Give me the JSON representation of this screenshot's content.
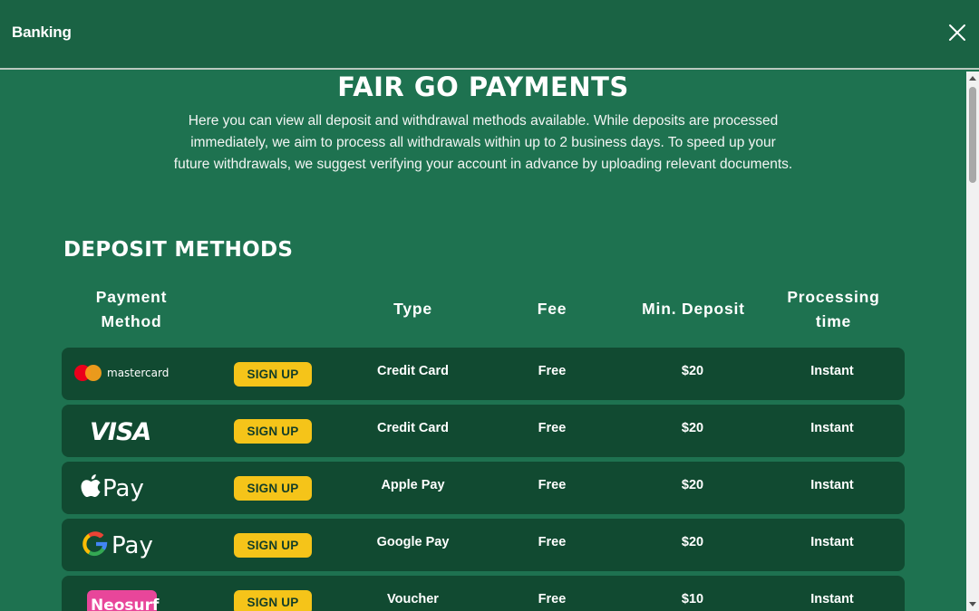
{
  "header": {
    "title": "Banking",
    "close_icon": "close-icon"
  },
  "page": {
    "title": "FAIR GO PAYMENTS",
    "intro": "Here you can view all deposit and withdrawal methods available. While deposits are processed immediately, we aim to process all withdrawals within up to 2 business days. To speed up your future withdrawals, we suggest verifying your account in advance by uploading relevant documents."
  },
  "deposit": {
    "title": "DEPOSIT METHODS",
    "columns": {
      "method": "Payment Method",
      "type": "Type",
      "fee": "Fee",
      "min": "Min. Deposit",
      "time": "Processing time"
    },
    "rows": [
      {
        "logo": "mastercard-logo",
        "logo_text": "mastercard",
        "button": "SIGN UP",
        "type": "Credit Card",
        "fee": "Free",
        "min": "$20",
        "time": "Instant"
      },
      {
        "logo": "visa-logo",
        "logo_text": "VISA",
        "button": "SIGN UP",
        "type": "Credit Card",
        "fee": "Free",
        "min": "$20",
        "time": "Instant"
      },
      {
        "logo": "apple-pay-logo",
        "logo_text": "Pay",
        "button": "SIGN UP",
        "type": "Apple Pay",
        "fee": "Free",
        "min": "$20",
        "time": "Instant"
      },
      {
        "logo": "google-pay-logo",
        "logo_text": "Pay",
        "button": "SIGN UP",
        "type": "Google Pay",
        "fee": "Free",
        "min": "$20",
        "time": "Instant"
      },
      {
        "logo": "neosurf-logo",
        "logo_text": "Neosurf",
        "button": "SIGN UP",
        "type": "Voucher",
        "fee": "Free",
        "min": "$10",
        "time": "Instant"
      }
    ]
  },
  "colors": {
    "background": "#1e7250",
    "header": "#1a6344",
    "row": "#114a31",
    "button": "#f5c419",
    "neosurf": "#e8469a"
  }
}
